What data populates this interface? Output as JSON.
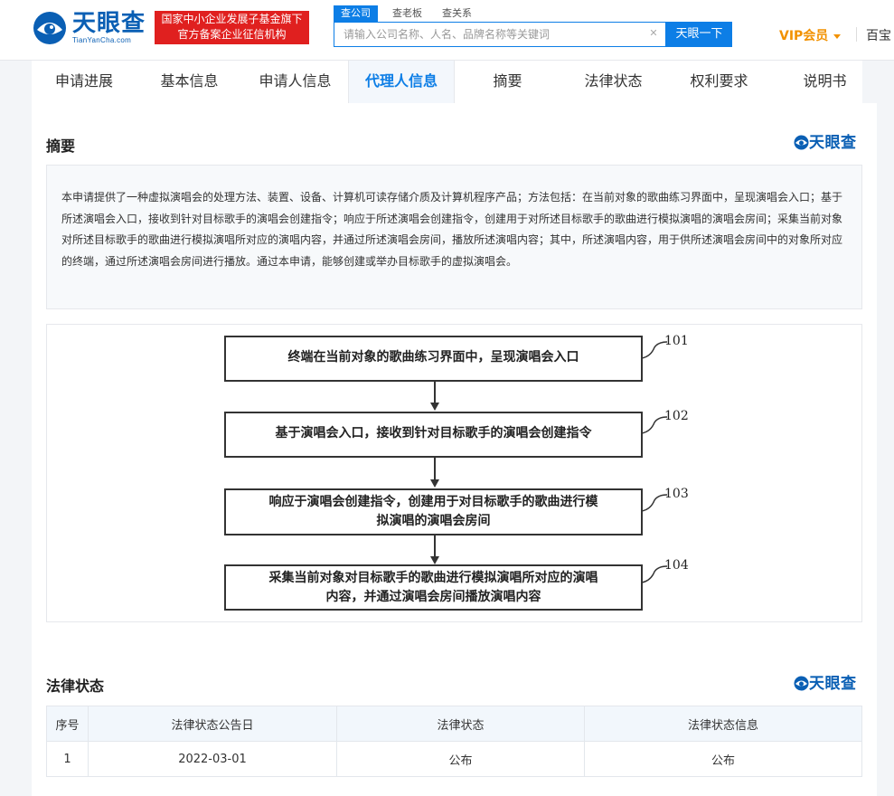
{
  "header": {
    "logo_text": "天眼查",
    "logo_sub": "TianYanCha.com",
    "gov_badge_line1": "国家中小企业发展子基金旗下",
    "gov_badge_line2": "官方备案企业征信机构",
    "search_tabs": [
      "查公司",
      "查老板",
      "查关系"
    ],
    "search_placeholder": "请输入公司名称、人名、品牌名称等关键词",
    "search_button": "天眼一下",
    "vip_label": "VIP会员",
    "baibao_label": "百宝"
  },
  "tabs": [
    "申请进展",
    "基本信息",
    "申请人信息",
    "代理人信息",
    "摘要",
    "法律状态",
    "权利要求",
    "说明书"
  ],
  "active_tab": "代理人信息",
  "abstract": {
    "title": "摘要",
    "brand": "天眼查",
    "text": "本申请提供了一种虚拟演唱会的处理方法、装置、设备、计算机可读存储介质及计算机程序产品；方法包括：在当前对象的歌曲练习界面中，呈现演唱会入口；基于所述演唱会入口，接收到针对目标歌手的演唱会创建指令；响应于所述演唱会创建指令，创建用于对所述目标歌手的歌曲进行模拟演唱的演唱会房间；采集当前对象对所述目标歌手的歌曲进行模拟演唱所对应的演唱内容，并通过所述演唱会房间，播放所述演唱内容；其中，所述演唱内容，用于供所述演唱会房间中的对象所对应的终端，通过所述演唱会房间进行播放。通过本申请，能够创建或举办目标歌手的虚拟演唱会。"
  },
  "flowchart": {
    "steps": [
      {
        "num": "101",
        "lines": [
          "终端在当前对象的歌曲练习界面中，呈现演唱会入口"
        ]
      },
      {
        "num": "102",
        "lines": [
          "基于演唱会入口，接收到针对目标歌手的演唱会创建指令"
        ]
      },
      {
        "num": "103",
        "lines": [
          "响应于演唱会创建指令，创建用于对目标歌手的歌曲进行模",
          "拟演唱的演唱会房间"
        ]
      },
      {
        "num": "104",
        "lines": [
          "采集当前对象对目标歌手的歌曲进行模拟演唱所对应的演唱",
          "内容，并通过演唱会房间播放演唱内容"
        ]
      }
    ]
  },
  "legal_status": {
    "title": "法律状态",
    "brand": "天眼查",
    "columns": [
      "序号",
      "法律状态公告日",
      "法律状态",
      "法律状态信息"
    ],
    "rows": [
      [
        "1",
        "2022-03-01",
        "公布",
        "公布"
      ]
    ]
  },
  "colors": {
    "brand_blue": "#0a5fb4",
    "accent_blue": "#0d7ee6",
    "badge_red": "#e0201f",
    "vip_orange": "#f29100"
  }
}
